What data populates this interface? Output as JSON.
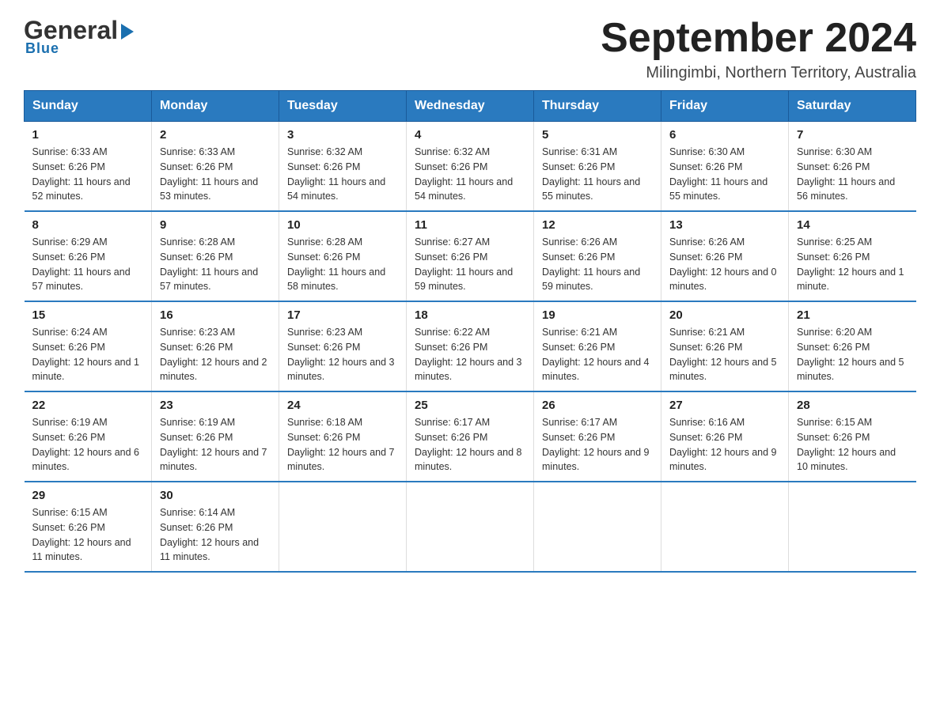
{
  "header": {
    "logo_general": "General",
    "logo_blue": "Blue",
    "title": "September 2024",
    "subtitle": "Milingimbi, Northern Territory, Australia"
  },
  "calendar": {
    "columns": [
      "Sunday",
      "Monday",
      "Tuesday",
      "Wednesday",
      "Thursday",
      "Friday",
      "Saturday"
    ],
    "weeks": [
      [
        null,
        null,
        null,
        null,
        null,
        null,
        null
      ]
    ],
    "days": {
      "1": {
        "sunrise": "6:33 AM",
        "sunset": "6:26 PM",
        "daylight": "11 hours and 52 minutes."
      },
      "2": {
        "sunrise": "6:33 AM",
        "sunset": "6:26 PM",
        "daylight": "11 hours and 53 minutes."
      },
      "3": {
        "sunrise": "6:32 AM",
        "sunset": "6:26 PM",
        "daylight": "11 hours and 54 minutes."
      },
      "4": {
        "sunrise": "6:32 AM",
        "sunset": "6:26 PM",
        "daylight": "11 hours and 54 minutes."
      },
      "5": {
        "sunrise": "6:31 AM",
        "sunset": "6:26 PM",
        "daylight": "11 hours and 55 minutes."
      },
      "6": {
        "sunrise": "6:30 AM",
        "sunset": "6:26 PM",
        "daylight": "11 hours and 55 minutes."
      },
      "7": {
        "sunrise": "6:30 AM",
        "sunset": "6:26 PM",
        "daylight": "11 hours and 56 minutes."
      },
      "8": {
        "sunrise": "6:29 AM",
        "sunset": "6:26 PM",
        "daylight": "11 hours and 57 minutes."
      },
      "9": {
        "sunrise": "6:28 AM",
        "sunset": "6:26 PM",
        "daylight": "11 hours and 57 minutes."
      },
      "10": {
        "sunrise": "6:28 AM",
        "sunset": "6:26 PM",
        "daylight": "11 hours and 58 minutes."
      },
      "11": {
        "sunrise": "6:27 AM",
        "sunset": "6:26 PM",
        "daylight": "11 hours and 59 minutes."
      },
      "12": {
        "sunrise": "6:26 AM",
        "sunset": "6:26 PM",
        "daylight": "11 hours and 59 minutes."
      },
      "13": {
        "sunrise": "6:26 AM",
        "sunset": "6:26 PM",
        "daylight": "12 hours and 0 minutes."
      },
      "14": {
        "sunrise": "6:25 AM",
        "sunset": "6:26 PM",
        "daylight": "12 hours and 1 minute."
      },
      "15": {
        "sunrise": "6:24 AM",
        "sunset": "6:26 PM",
        "daylight": "12 hours and 1 minute."
      },
      "16": {
        "sunrise": "6:23 AM",
        "sunset": "6:26 PM",
        "daylight": "12 hours and 2 minutes."
      },
      "17": {
        "sunrise": "6:23 AM",
        "sunset": "6:26 PM",
        "daylight": "12 hours and 3 minutes."
      },
      "18": {
        "sunrise": "6:22 AM",
        "sunset": "6:26 PM",
        "daylight": "12 hours and 3 minutes."
      },
      "19": {
        "sunrise": "6:21 AM",
        "sunset": "6:26 PM",
        "daylight": "12 hours and 4 minutes."
      },
      "20": {
        "sunrise": "6:21 AM",
        "sunset": "6:26 PM",
        "daylight": "12 hours and 5 minutes."
      },
      "21": {
        "sunrise": "6:20 AM",
        "sunset": "6:26 PM",
        "daylight": "12 hours and 5 minutes."
      },
      "22": {
        "sunrise": "6:19 AM",
        "sunset": "6:26 PM",
        "daylight": "12 hours and 6 minutes."
      },
      "23": {
        "sunrise": "6:19 AM",
        "sunset": "6:26 PM",
        "daylight": "12 hours and 7 minutes."
      },
      "24": {
        "sunrise": "6:18 AM",
        "sunset": "6:26 PM",
        "daylight": "12 hours and 7 minutes."
      },
      "25": {
        "sunrise": "6:17 AM",
        "sunset": "6:26 PM",
        "daylight": "12 hours and 8 minutes."
      },
      "26": {
        "sunrise": "6:17 AM",
        "sunset": "6:26 PM",
        "daylight": "12 hours and 9 minutes."
      },
      "27": {
        "sunrise": "6:16 AM",
        "sunset": "6:26 PM",
        "daylight": "12 hours and 9 minutes."
      },
      "28": {
        "sunrise": "6:15 AM",
        "sunset": "6:26 PM",
        "daylight": "12 hours and 10 minutes."
      },
      "29": {
        "sunrise": "6:15 AM",
        "sunset": "6:26 PM",
        "daylight": "12 hours and 11 minutes."
      },
      "30": {
        "sunrise": "6:14 AM",
        "sunset": "6:26 PM",
        "daylight": "12 hours and 11 minutes."
      }
    }
  }
}
